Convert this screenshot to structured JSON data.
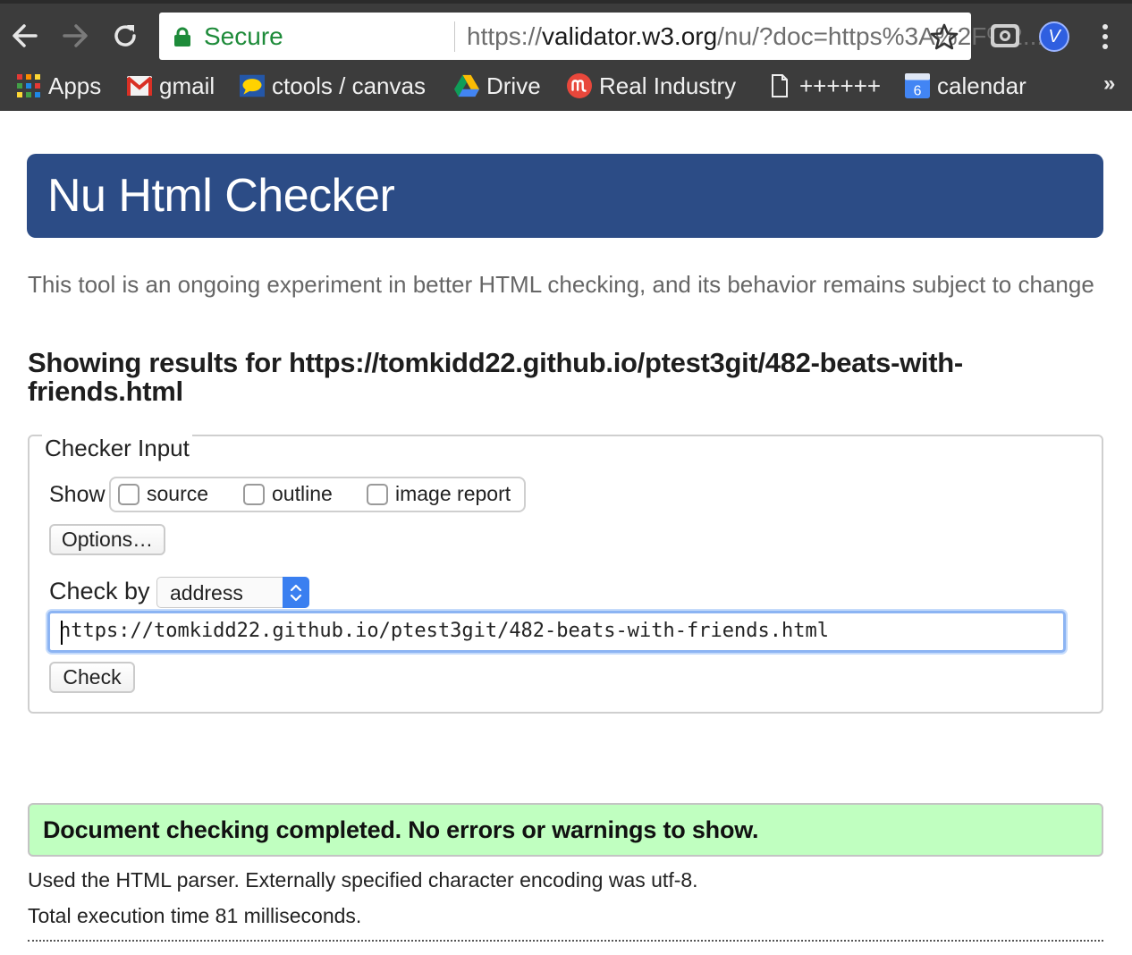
{
  "browser": {
    "secure_label": "Secure",
    "url_scheme": "https://",
    "url_host": "validator.w3.org",
    "url_rest": "/nu/?doc=https%3A%2F%2...",
    "extension_badge": "V",
    "bookmarks": [
      {
        "label": "Apps",
        "icon": "apps-grid-icon"
      },
      {
        "label": "gmail",
        "icon": "gmail-icon"
      },
      {
        "label": "ctools / canvas",
        "icon": "chat-bubble-icon"
      },
      {
        "label": "Drive",
        "icon": "drive-icon"
      },
      {
        "label": "Real Industry",
        "icon": "real-industry-icon"
      },
      {
        "label": "++++++",
        "icon": "page-icon"
      },
      {
        "label": "calendar",
        "icon": "calendar-icon",
        "icon_text": "6"
      }
    ],
    "bookmarks_overflow": "»"
  },
  "page": {
    "banner_title": "Nu Html Checker",
    "intro": "This tool is an ongoing experiment in better HTML checking, and its behavior remains subject to change",
    "results_heading": "Showing results for https://tomkidd22.github.io/ptest3git/482-beats-with-friends.html",
    "checker": {
      "legend": "Checker Input",
      "show_label": "Show",
      "options": [
        {
          "label": "source",
          "checked": false
        },
        {
          "label": "outline",
          "checked": false
        },
        {
          "label": "image report",
          "checked": false
        }
      ],
      "options_button": "Options…",
      "check_by_label": "Check by",
      "check_by_value": "address",
      "url_value": "https://tomkidd22.github.io/ptest3git/482-beats-with-friends.html",
      "check_button": "Check"
    },
    "success_message": "Document checking completed. No errors or warnings to show.",
    "parser_info": "Used the HTML parser. Externally specified character encoding was utf-8.",
    "execution_time": "Total execution time 81 milliseconds."
  },
  "colors": {
    "banner": "#2c4c86",
    "success_bg": "#c0ffc0",
    "secure_green": "#1e8b3a",
    "chrome_bg": "#3c3c3c",
    "focus_ring": "#8cb4f3"
  }
}
